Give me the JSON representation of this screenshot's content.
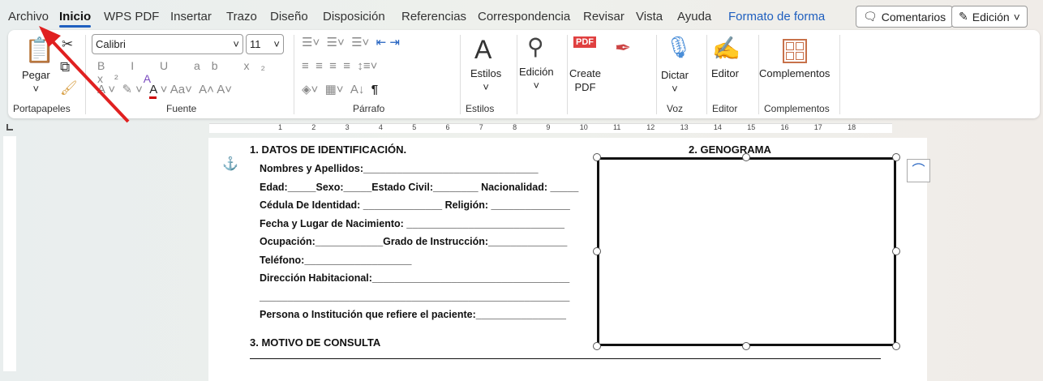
{
  "menu": {
    "tabs": [
      "Archivo",
      "Inicio",
      "WPS PDF",
      "Insertar",
      "Trazo",
      "Diseño",
      "Disposición",
      "Referencias",
      "Correspondencia",
      "Revisar",
      "Vista",
      "Ayuda",
      "Formato de forma"
    ],
    "comments": "Comentarios",
    "editing": "Edición"
  },
  "ribbon": {
    "paste": "Pegar",
    "font": "Calibri",
    "size": "11",
    "styles": "Estilos",
    "edit": "Edición",
    "create_pdf": "Create\nPDF",
    "dictate": "Dictar",
    "editor": "Editor",
    "addins": "Complementos",
    "groups": {
      "clipboard": "Portapapeles",
      "font": "Fuente",
      "paragraph": "Párrafo",
      "styles": "Estilos",
      "voice": "Voz",
      "editor": "Editor",
      "addins": "Complementos"
    }
  },
  "ruler": [
    "1",
    "2",
    "3",
    "4",
    "5",
    "6",
    "7",
    "8",
    "9",
    "10",
    "11",
    "12",
    "13",
    "14",
    "15",
    "16",
    "17",
    "18"
  ],
  "doc": {
    "h1": "1. DATOS DE IDENTIFICACIÓN.",
    "h2": "2. GENOGRAMA",
    "h3": "3. MOTIVO DE CONSULTA",
    "lines": [
      "Nombres y Apellidos:_______________________________",
      "Edad:_____Sexo:_____Estado Civil:________ Nacionalidad: _____",
      "Cédula De Identidad: ______________ Religión: ______________",
      "Fecha y Lugar de Nacimiento: ____________________________",
      "Ocupación:____________Grado de Instrucción:______________",
      "Teléfono:___________________",
      "Dirección Habitacional:___________________________________",
      "_______________________________________________________",
      "Persona o Institución que refiere el paciente:________________"
    ]
  }
}
